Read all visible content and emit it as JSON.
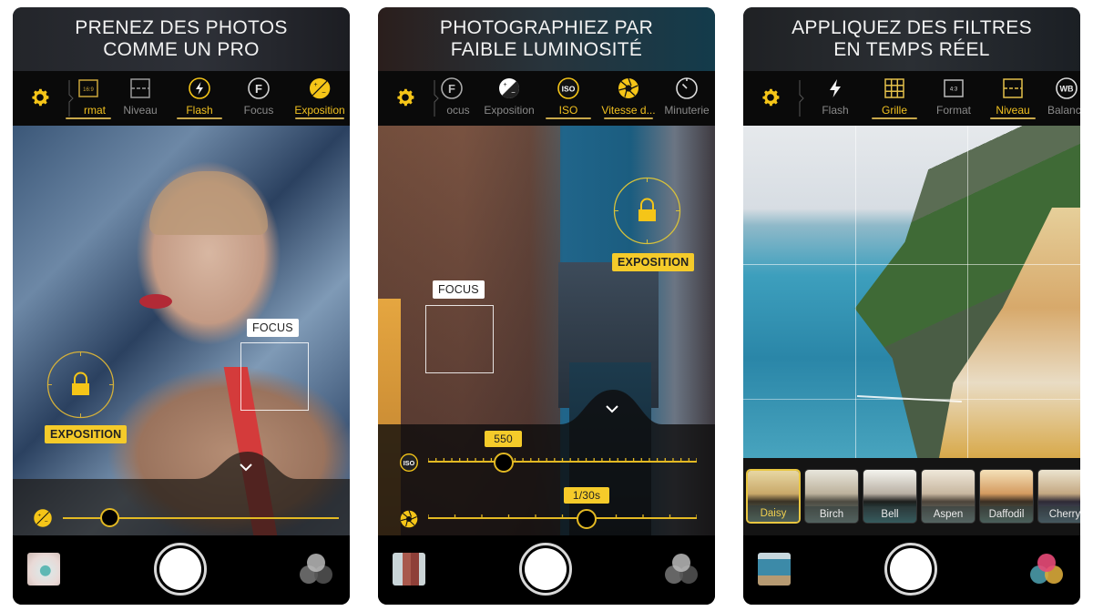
{
  "colors": {
    "accent_yellow": "#f5cb2a",
    "inactive_gray": "#8a8a8a",
    "toolbar_bg": "#0a0a0a"
  },
  "panels": [
    {
      "headline": [
        "PRENEZ DES PHOTOS",
        "COMME UN PRO"
      ],
      "toolbar": {
        "settings_icon": "gear-icon",
        "tools": [
          {
            "label": "Format",
            "shown_label": "rmat",
            "icon": "aspect-16-9-icon",
            "active": true
          },
          {
            "label": "Niveau",
            "icon": "level-icon",
            "active": false
          },
          {
            "label": "Flash",
            "icon": "flash-icon",
            "active": true
          },
          {
            "label": "Focus",
            "icon": "focus-f-icon",
            "active": false
          },
          {
            "label": "Exposition",
            "icon": "exposure-icon",
            "active": true
          }
        ]
      },
      "overlays": {
        "focus_label": "FOCUS",
        "exposure_label": "EXPOSITION"
      },
      "sliders": [
        {
          "name": "exposure",
          "icon": "exposure-icon",
          "value_fraction": 0.17
        }
      ]
    },
    {
      "headline": [
        "PHOTOGRAPHIEZ PAR",
        "FAIBLE LUMINOSITÉ"
      ],
      "toolbar": {
        "settings_icon": "gear-icon",
        "tools": [
          {
            "label": "Focus",
            "shown_label": "ocus",
            "icon": "focus-f-icon",
            "active": false
          },
          {
            "label": "Exposition",
            "icon": "exposure-icon",
            "active": false
          },
          {
            "label": "ISO",
            "icon": "iso-icon",
            "active": true
          },
          {
            "label": "Vitesse d...",
            "icon": "aperture-icon",
            "active": true
          },
          {
            "label": "Minuterie",
            "icon": "timer-icon",
            "active": false
          }
        ]
      },
      "overlays": {
        "focus_label": "FOCUS",
        "exposure_label": "EXPOSITION"
      },
      "sliders": [
        {
          "name": "iso",
          "icon": "iso-icon",
          "value_label": "550",
          "value_fraction": 0.28
        },
        {
          "name": "shutter-speed",
          "icon": "aperture-icon",
          "value_label": "1/30s",
          "value_fraction": 0.59
        }
      ]
    },
    {
      "headline": [
        "APPLIQUEZ DES FILTRES",
        "EN TEMPS RÉEL"
      ],
      "toolbar": {
        "settings_icon": "gear-icon",
        "tools": [
          {
            "label": "Flash",
            "icon": "flash-icon",
            "active": false
          },
          {
            "label": "Grille",
            "icon": "grid-icon",
            "active": true
          },
          {
            "label": "Format",
            "icon": "aspect-4-3-icon",
            "active": false
          },
          {
            "label": "Niveau",
            "icon": "level-icon",
            "active": true
          },
          {
            "label": "Balance",
            "shown_label": "Balanc",
            "icon": "white-balance-icon",
            "active": false
          }
        ]
      },
      "filters": [
        {
          "label": "Daisy",
          "selected": true
        },
        {
          "label": "Birch",
          "selected": false
        },
        {
          "label": "Bell",
          "selected": false
        },
        {
          "label": "Aspen",
          "selected": false
        },
        {
          "label": "Daffodil",
          "selected": false
        },
        {
          "label": "Cherry",
          "selected": false
        }
      ]
    }
  ],
  "aspect_text": {
    "format_16_9": "16:9",
    "format_4_3": "4:3",
    "wb": "WB",
    "iso": "ISO",
    "f": "F"
  }
}
